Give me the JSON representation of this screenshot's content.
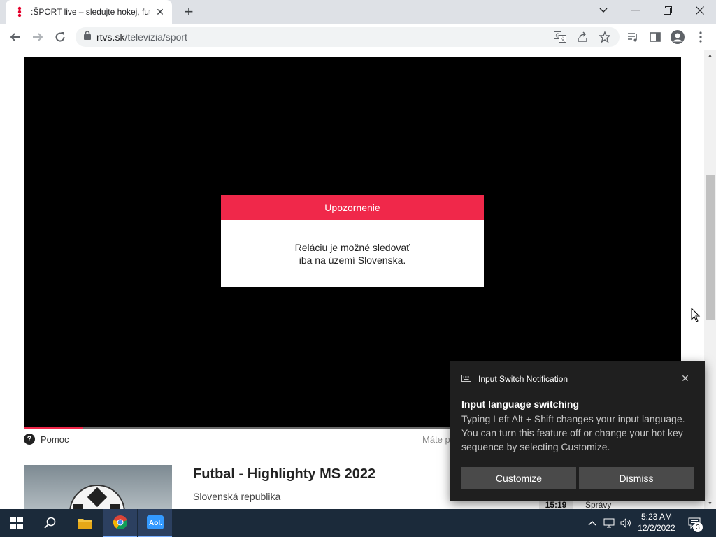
{
  "browser": {
    "tab": {
      "title": ":ŠPORT live – sledujte hokej, futb"
    },
    "address": {
      "domain": "rtvs.sk",
      "path": "/televizia/sport"
    }
  },
  "player": {
    "progress": 0.09,
    "alert": {
      "heading": "Upozornenie",
      "line1": "Reláciu je možné sledovať",
      "line2": "iba na území Slovenska."
    }
  },
  "page": {
    "help_label": "Pomoc",
    "mate_label": "Máte p",
    "article": {
      "title": "Futbal - Highlighty MS 2022",
      "subtitle": "Slovenská republika"
    },
    "news": {
      "time": "15:19",
      "label": "Správy"
    }
  },
  "notification": {
    "app": "Input Switch Notification",
    "title": "Input language switching",
    "body": "Typing Left Alt + Shift changes your input language. You can turn this feature off or change your hot key sequence by selecting Customize.",
    "customize": "Customize",
    "dismiss": "Dismiss"
  },
  "taskbar": {
    "time": "5:23 AM",
    "date": "12/2/2022",
    "notification_count": "3"
  },
  "colors": {
    "accent": "#f0284a"
  }
}
